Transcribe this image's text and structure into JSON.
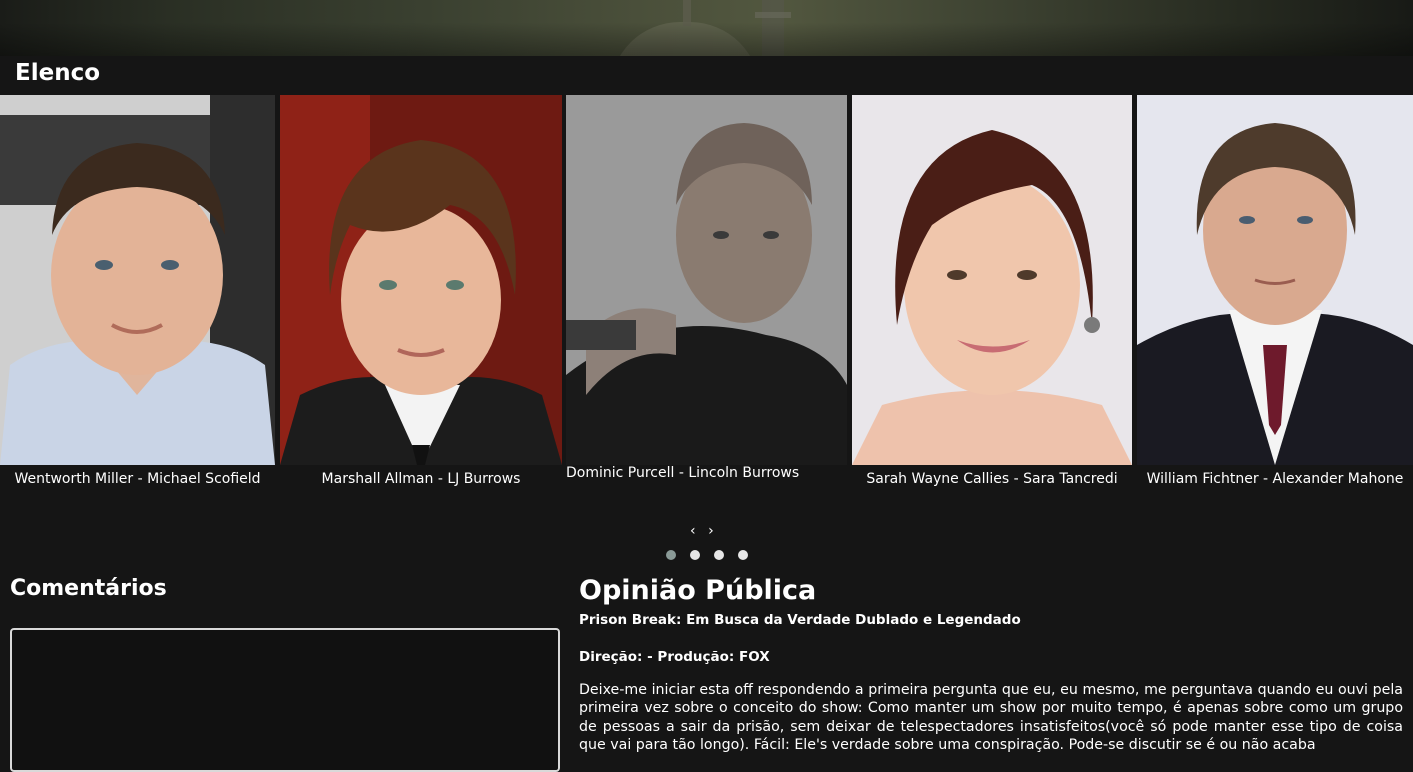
{
  "cast_section": {
    "title": "Elenco",
    "members": [
      {
        "caption": "Wentworth Miller - Michael Scofield"
      },
      {
        "caption": "Marshall Allman - LJ Burrows"
      },
      {
        "caption": "Dominic Purcell - Lincoln Burrows"
      },
      {
        "caption": "Sarah Wayne Callies - Sara Tancredi"
      },
      {
        "caption": "William Fichtner - Alexander Mahone"
      }
    ],
    "carousel": {
      "prev_label": "‹",
      "next_label": "›",
      "dot_count": 4,
      "active_dot": 1
    }
  },
  "comments_section": {
    "title": "Comentários"
  },
  "opinion_section": {
    "title": "Opinião Pública",
    "show_title": "Prison Break: Em Busca da Verdade Dublado e Legendado",
    "credits": "Direção: - Produção: FOX",
    "body": "Deixe-me iniciar esta off respondendo a primeira pergunta que eu, eu mesmo, me perguntava quando eu ouvi pela primeira vez sobre o conceito do show: Como manter um show por muito tempo, é apenas sobre como um grupo de pessoas a sair da prisão, sem deixar de telespectadores insatisfeitos(você só pode manter esse tipo de coisa que vai para tão longo). Fácil: Ele's verdade sobre uma conspiração. Pode-se discutir se é ou não acaba"
  },
  "colors": {
    "page_background": "#151515",
    "text": "#ffffff",
    "dot_active": "#8a9a97",
    "dot_inactive": "#e6e6e6",
    "comment_border": "#d9d9d9"
  }
}
